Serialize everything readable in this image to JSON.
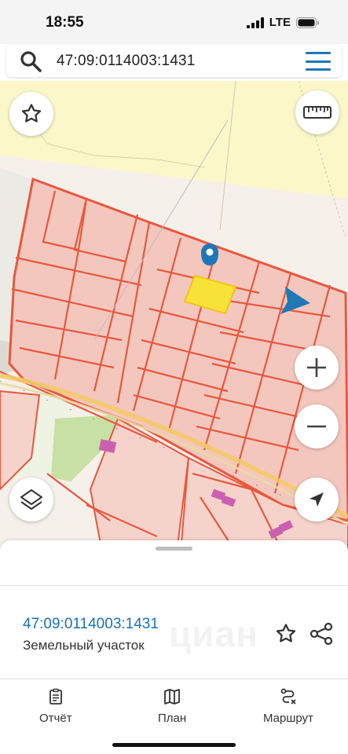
{
  "status_bar": {
    "time": "18:55",
    "network": "LTE"
  },
  "search": {
    "query": "47:09:0114003:1431"
  },
  "map": {
    "buttons": [
      "favorite",
      "ruler",
      "zoom-in",
      "zoom-out",
      "layers",
      "my-location"
    ],
    "colors": {
      "parcel_fill": "#f3c7bd",
      "parcel_stroke": "#e9573f",
      "selected": "#f7e338",
      "marker": "#1f78b4"
    }
  },
  "sheet": {
    "parcel_id": "47:09:0114003:1431",
    "parcel_type": "Земельный участок",
    "watermark": "циан"
  },
  "nav": {
    "report": "Отчёт",
    "plan": "План",
    "route": "Маршрут"
  }
}
